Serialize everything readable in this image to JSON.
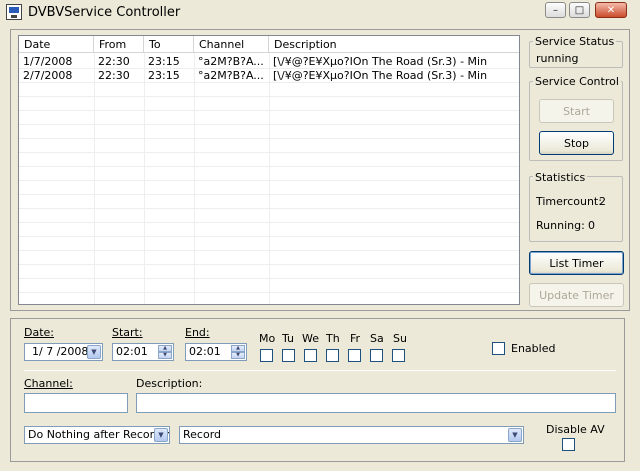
{
  "window": {
    "title": "DVBVService Controller"
  },
  "timer_list": {
    "columns": [
      "Date",
      "From",
      "To",
      "Channel",
      "Description"
    ],
    "rows": [
      {
        "date": "1/7/2008",
        "from": "22:30",
        "to": "23:15",
        "channel": "°a2M?B?A...",
        "description": "[\\/¥@?E¥Xµo?IOn The Road (Sr.3) - Min"
      },
      {
        "date": "2/7/2008",
        "from": "22:30",
        "to": "23:15",
        "channel": "°a2M?B?A...",
        "description": "[\\/¥@?E¥Xµo?IOn The Road (Sr.3) - Min"
      }
    ]
  },
  "service_status": {
    "label": "Service Status",
    "value": "running"
  },
  "service_control": {
    "label": "Service Control",
    "start": "Start",
    "stop": "Stop"
  },
  "statistics": {
    "label": "Statistics",
    "timercount_label": "Timercount:",
    "timercount": "2",
    "running_label": "Running:",
    "running": "0"
  },
  "buttons": {
    "list_timer": "List Timer",
    "update_timer": "Update Timer"
  },
  "form": {
    "date_label": "Date:",
    "date_value": "1/ 7 /2008",
    "start_label": "Start:",
    "start_value": "02:01",
    "end_label": "End:",
    "end_value": "02:01",
    "days": [
      "Mo",
      "Tu",
      "We",
      "Th",
      "Fr",
      "Sa",
      "Su"
    ],
    "enabled_label": "Enabled",
    "channel_label": "Channel:",
    "channel_value": "",
    "description_label": "Description:",
    "description_value": "",
    "after_recording_value": "Do Nothing after Recording",
    "mode_value": "Record",
    "disable_av_label": "Disable AV"
  }
}
